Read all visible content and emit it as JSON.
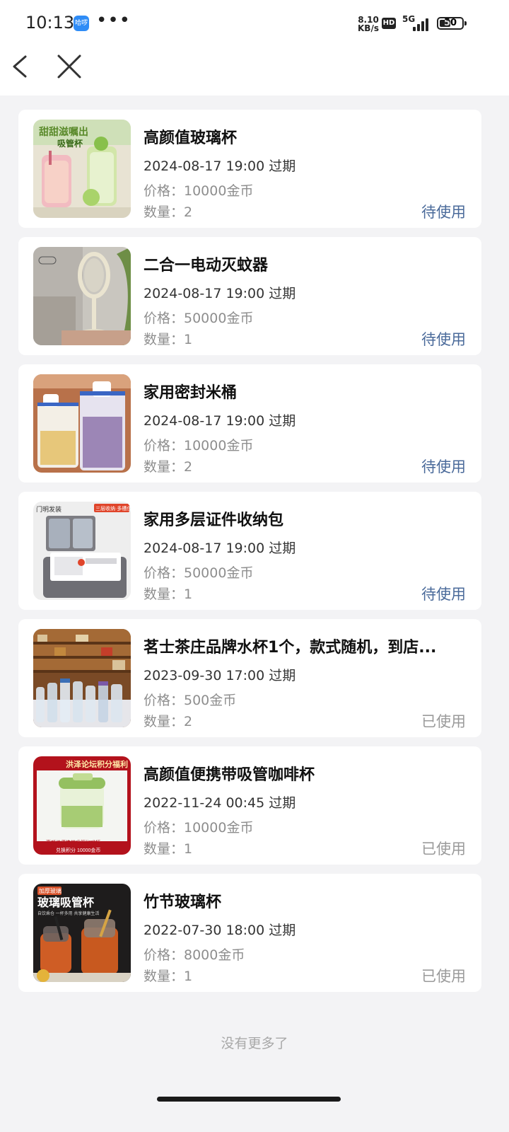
{
  "status_bar": {
    "time": "10:13",
    "app_badge": "哈啰",
    "more": "•••",
    "net_speed_value": "8.10",
    "net_speed_unit": "KB/s",
    "hd": "HD",
    "network": "5G",
    "battery": "50",
    "battery_level": 0.5
  },
  "nav": {
    "back_icon": "chevron-left-icon",
    "close_icon": "close-icon"
  },
  "labels": {
    "expiry_suffix": "过期",
    "price_label": "价格：",
    "qty_label": "数量：",
    "currency": "金币"
  },
  "items": [
    {
      "title": "高颜值玻璃杯",
      "expiry": "2024-08-17 19:00 过期",
      "price": "价格：10000金币",
      "qty": "数量：2",
      "status": "待使用",
      "state": "pending",
      "thumb": "glass-cup"
    },
    {
      "title": "二合一电动灭蚊器",
      "expiry": "2024-08-17 19:00 过期",
      "price": "价格：50000金币",
      "qty": "数量：1",
      "status": "待使用",
      "state": "pending",
      "thumb": "mosquito-swatter"
    },
    {
      "title": "家用密封米桶",
      "expiry": "2024-08-17 19:00 过期",
      "price": "价格：10000金币",
      "qty": "数量：2",
      "status": "待使用",
      "state": "pending",
      "thumb": "rice-bucket"
    },
    {
      "title": "家用多层证件收纳包",
      "expiry": "2024-08-17 19:00 过期",
      "price": "价格：50000金币",
      "qty": "数量：1",
      "status": "待使用",
      "state": "pending",
      "thumb": "document-bag"
    },
    {
      "title": "茗士茶庄品牌水杯1个，款式随机，到店...",
      "expiry": "2023-09-30 17:00 过期",
      "price": "价格：500金币",
      "qty": "数量：2",
      "status": "已使用",
      "state": "used",
      "thumb": "tea-shop-bottles"
    },
    {
      "title": "高颜值便携带吸管咖啡杯",
      "expiry": "2022-11-24 00:45 过期",
      "price": "价格：10000金币",
      "qty": "数量：1",
      "status": "已使用",
      "state": "used",
      "thumb": "coffee-cup"
    },
    {
      "title": "竹节玻璃杯",
      "expiry": "2022-07-30 18:00 过期",
      "price": "价格：8000金币",
      "qty": "数量：1",
      "status": "已使用",
      "state": "used",
      "thumb": "bamboo-glass"
    }
  ],
  "thumb_text": {
    "glass_cup": "甜甜滋嘱出",
    "glass_cup_2": "吸管杯",
    "coffee_banner": "洪泽论坛积分福利",
    "coffee_caption": "高颜值便携带吸管咖啡杯",
    "coffee_price": "兑换积分 10000金币",
    "bamboo_tag": "加厚玻璃",
    "bamboo_title": "玻璃吸管杯",
    "bamboo_sub": "自饮乘仓 一杯多用 共享健康生活",
    "bag_tag": "门明发装",
    "bag_corner": "三层收纳·多槽位"
  },
  "footer": {
    "no_more": "没有更多了"
  }
}
